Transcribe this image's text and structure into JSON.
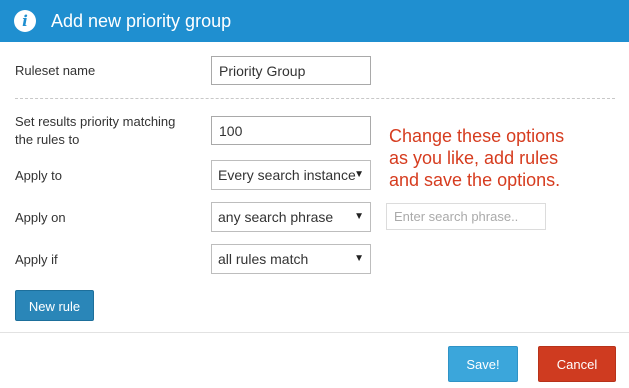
{
  "header": {
    "icon": "info-icon",
    "icon_glyph": "i",
    "title": "Add new priority group",
    "background": "#1f8fd0"
  },
  "form": {
    "ruleset_name": {
      "label": "Ruleset name",
      "value": "Priority Group"
    },
    "priority": {
      "label_line1": "Set results priority matching",
      "label_line2": "the rules to",
      "value": "100"
    },
    "apply_to": {
      "label": "Apply to",
      "selected": "Every search instance"
    },
    "apply_on": {
      "label": "Apply on",
      "selected": "any search phrase",
      "phrase_placeholder": "Enter search phrase.."
    },
    "apply_if": {
      "label": "Apply if",
      "selected": "all rules match"
    }
  },
  "note": {
    "line1": "Change these options",
    "line2": "as you like, add rules",
    "line3": "and save the options.",
    "color": "#d63c1f"
  },
  "buttons": {
    "new_rule": "New rule",
    "save": "Save!",
    "cancel": "Cancel"
  },
  "icons": {
    "select_caret": "▼"
  }
}
